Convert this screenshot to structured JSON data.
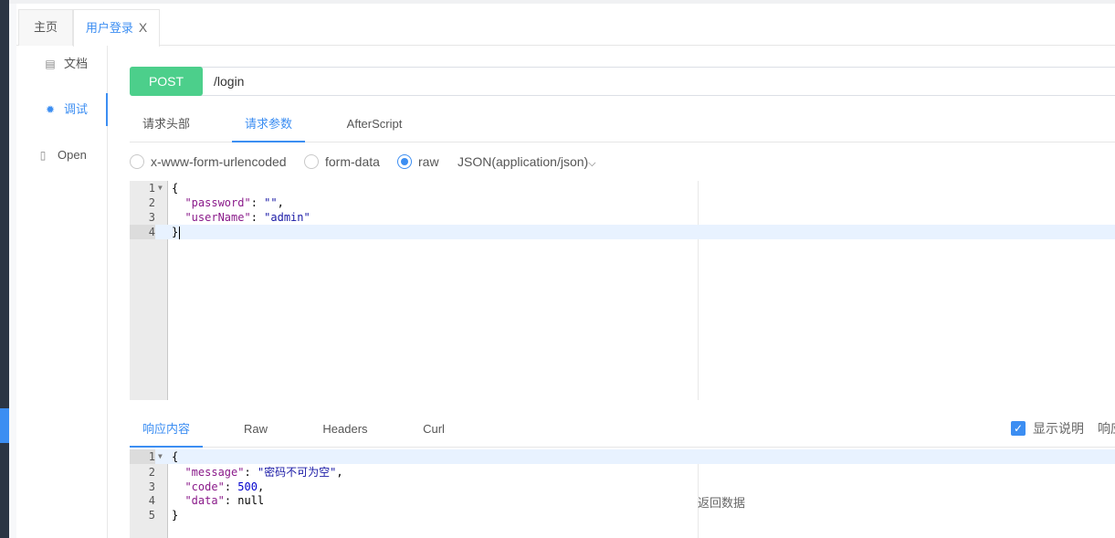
{
  "tabs": [
    {
      "label": "主页"
    },
    {
      "label": "用户登录",
      "close": "X"
    }
  ],
  "sidebar": {
    "items": [
      {
        "label": "文档",
        "icon": "document-icon"
      },
      {
        "label": "调试",
        "icon": "bug-icon"
      },
      {
        "label": "Open",
        "icon": "file-icon"
      }
    ]
  },
  "request": {
    "method": "POST",
    "url": "/login"
  },
  "request_tabs": [
    {
      "label": "请求头部"
    },
    {
      "label": "请求参数"
    },
    {
      "label": "AfterScript"
    }
  ],
  "body_types": [
    {
      "label": "x-www-form-urlencoded",
      "checked": false
    },
    {
      "label": "form-data",
      "checked": false
    },
    {
      "label": "raw",
      "checked": true
    }
  ],
  "content_type": "JSON(application/json)",
  "request_body": {
    "line_numbers": [
      "1",
      "2",
      "3",
      "4"
    ],
    "lines": [
      "{",
      "\"password\": \"\",",
      "\"userName\": \"admin\"",
      "}"
    ]
  },
  "response_tabs": [
    {
      "label": "响应内容"
    },
    {
      "label": "Raw"
    },
    {
      "label": "Headers"
    },
    {
      "label": "Curl"
    }
  ],
  "show_description": {
    "label": "显示说明",
    "checked": true
  },
  "response_partial_label": "响应",
  "response_body": {
    "line_numbers": [
      "1",
      "2",
      "3",
      "4",
      "5"
    ],
    "lines": [
      "{",
      "\"message\": \"密码不可为空\",",
      "\"code\": 500,",
      "\"data\": null",
      "}"
    ]
  },
  "return_data_label": "返回数据",
  "colors": {
    "accent": "#3c8ef2",
    "method": "#4ccf8b"
  }
}
